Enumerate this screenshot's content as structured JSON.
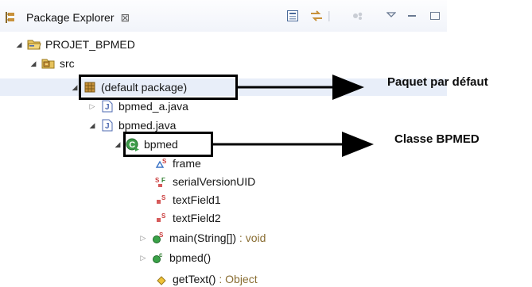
{
  "view": {
    "tab_label": "Package Explorer",
    "close_glyph": "⊠"
  },
  "tree": [
    {
      "id": "project",
      "label": "PROJET_BPMED",
      "icon": "project-folder-icon"
    },
    {
      "id": "src",
      "label": "src",
      "icon": "source-folder-icon"
    },
    {
      "id": "default-package",
      "label": "(default package)",
      "icon": "package-icon"
    },
    {
      "id": "bpmed-a-java",
      "label": "bpmed_a.java",
      "icon": "java-file-icon"
    },
    {
      "id": "bpmed-java",
      "label": "bpmed.java",
      "icon": "java-file-icon"
    },
    {
      "id": "bpmed-class",
      "label": "bpmed",
      "icon": "class-icon"
    },
    {
      "id": "frame",
      "label": "frame",
      "icon": "static-field-icon"
    },
    {
      "id": "serial",
      "label": "serialVersionUID",
      "icon": "static-final-field-icon"
    },
    {
      "id": "textfield1",
      "label": "textField1",
      "icon": "private-static-field-icon"
    },
    {
      "id": "textfield2",
      "label": "textField2",
      "icon": "private-static-field-icon"
    },
    {
      "id": "main",
      "label": "main(String[])",
      "suffix": " : void",
      "icon": "public-static-method-icon"
    },
    {
      "id": "ctor",
      "label": "bpmed()",
      "icon": "constructor-icon"
    },
    {
      "id": "gettext",
      "label": "getText()",
      "suffix": " : Object",
      "icon": "protected-method-icon"
    }
  ],
  "annotations": {
    "default_package": "Paquet par défaut",
    "class": "Classe BPMED"
  },
  "colors": {
    "annotation_border": "#000000",
    "tabbar_bg": "#f1f4fa"
  }
}
